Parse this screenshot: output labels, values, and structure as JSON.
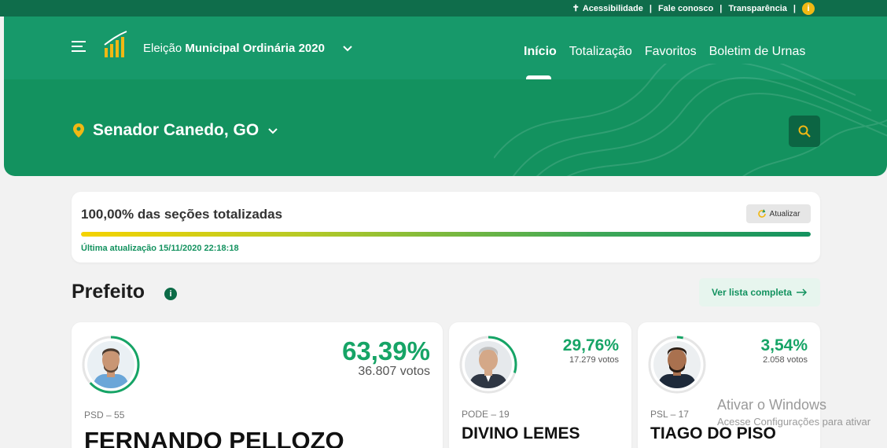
{
  "topbar": {
    "accessibility": "Acessibilidade",
    "contact": "Fale conosco",
    "transparency": "Transparência",
    "separator": "|"
  },
  "header": {
    "election_prefix": "Eleição",
    "election_name": "Municipal Ordinária 2020",
    "nav": [
      "Início",
      "Totalização",
      "Favoritos",
      "Boletim de Urnas"
    ],
    "location": "Senador Canedo, GO"
  },
  "progress": {
    "label": "100,00% das seções totalizadas",
    "value": 1.0,
    "refresh_label": "Atualizar",
    "last_update": "Última atualização 15/11/2020 22:18:18"
  },
  "section": {
    "title": "Prefeito",
    "list_button": "Ver lista completa"
  },
  "candidates": [
    {
      "party": "PSD – 55",
      "name": "FERNANDO PELLOZO",
      "percent": "63,39%",
      "votes": "36.807 votos",
      "share": 0.6339
    },
    {
      "party": "PODE – 19",
      "name": "DIVINO LEMES",
      "percent": "29,76%",
      "votes": "17.279 votos",
      "share": 0.2976
    },
    {
      "party": "PSL – 17",
      "name": "TIAGO DO PISO",
      "percent": "3,54%",
      "votes": "2.058 votos",
      "share": 0.0354
    }
  ],
  "windows": {
    "title": "Ativar o Windows",
    "subtitle": "Acesse Configurações para ativar"
  },
  "colors": {
    "primary": "#13925f",
    "dark": "#0f6d4b",
    "accent": "#f1b814",
    "percent": "#16a466"
  }
}
